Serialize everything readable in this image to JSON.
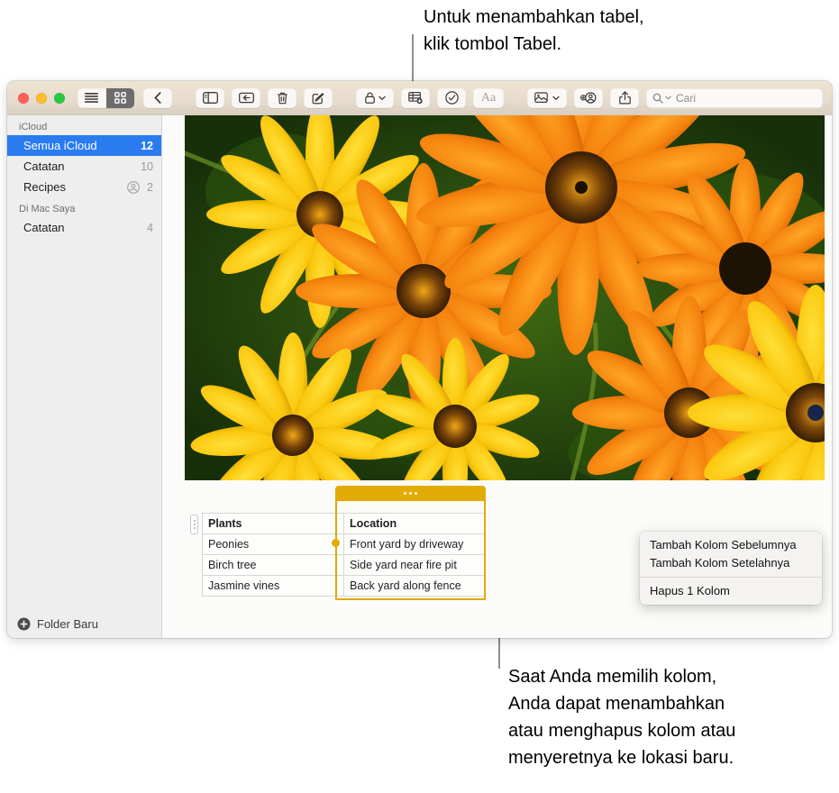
{
  "callouts": {
    "top": "Untuk menambahkan tabel,\nklik tombol Tabel.",
    "bottom": "Saat Anda memilih kolom,\nAnda dapat menambahkan\natau menghapus kolom atau\nmenyeretnya ke lokasi baru."
  },
  "toolbar": {
    "view_list": "list-view",
    "view_grid": "grid-view",
    "back": "back",
    "sidebar_toggle": "sidebar-toggle",
    "folder_move": "move-to-folder",
    "delete": "delete-note",
    "compose": "compose-note",
    "lock": "lock-note",
    "table": "add-table",
    "checklist": "checklist",
    "format": "Aa",
    "media": "add-media",
    "add_people": "add-people",
    "share": "share",
    "accent_selected": "#6d6d6d"
  },
  "search": {
    "placeholder": "Cari"
  },
  "sidebar": {
    "sections": [
      {
        "title": "iCloud",
        "items": [
          {
            "label": "Semua iCloud",
            "count": "12",
            "selected": true,
            "shared": false
          },
          {
            "label": "Catatan",
            "count": "10",
            "selected": false,
            "shared": false
          },
          {
            "label": "Recipes",
            "count": "2",
            "selected": false,
            "shared": true
          }
        ]
      },
      {
        "title": "Di Mac Saya",
        "items": [
          {
            "label": "Catatan",
            "count": "4",
            "selected": false,
            "shared": false
          }
        ]
      }
    ],
    "new_folder_label": "Folder Baru",
    "selection_color": "#2a7bf0"
  },
  "note": {
    "photo_alt": "orange-and-yellow-daisy-flowers-photo",
    "table": {
      "headers": [
        "Plants",
        "Location"
      ],
      "rows": [
        [
          "Peonies",
          "Front yard by driveway"
        ],
        [
          "Birch tree",
          "Side yard near fire pit"
        ],
        [
          "Jasmine vines",
          "Back yard along fence"
        ]
      ],
      "selected_column_index": 1,
      "selection_color": "#e3ab07"
    }
  },
  "context_menu": {
    "items": [
      {
        "label": "Tambah Kolom Sebelumnya",
        "separator_after": false
      },
      {
        "label": "Tambah Kolom Setelahnya",
        "separator_after": true
      },
      {
        "label": "Hapus 1 Kolom",
        "separator_after": false
      }
    ]
  }
}
